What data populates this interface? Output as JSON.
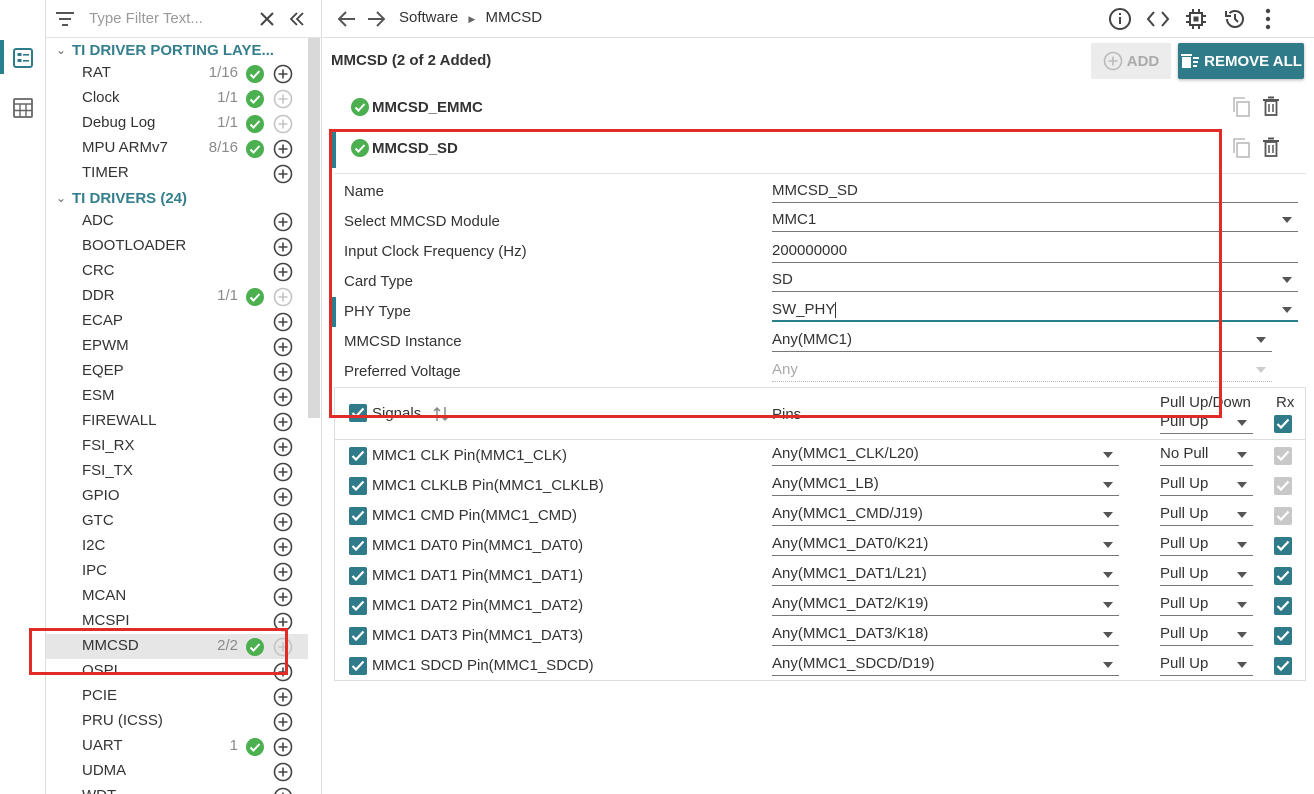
{
  "rail": {
    "items": [
      {
        "icon": "config-list-icon",
        "selected": true
      },
      {
        "icon": "calculator-icon",
        "selected": false
      }
    ]
  },
  "filter": {
    "placeholder": "Type Filter Text..."
  },
  "sections": [
    {
      "title": "TI DRIVER PORTING LAYE...",
      "items": [
        {
          "label": "RAT",
          "count": "1/16",
          "ok": true
        },
        {
          "label": "Clock",
          "count": "1/1",
          "ok": true,
          "add_disabled": true
        },
        {
          "label": "Debug Log",
          "count": "1/1",
          "ok": true,
          "add_disabled": true
        },
        {
          "label": "MPU ARMv7",
          "count": "8/16",
          "ok": true
        },
        {
          "label": "TIMER",
          "count": "",
          "ok": false
        }
      ]
    },
    {
      "title": "TI DRIVERS (24)",
      "items": [
        {
          "label": "ADC",
          "count": ""
        },
        {
          "label": "BOOTLOADER",
          "count": ""
        },
        {
          "label": "CRC",
          "count": ""
        },
        {
          "label": "DDR",
          "count": "1/1",
          "ok": true,
          "add_disabled": true
        },
        {
          "label": "ECAP",
          "count": ""
        },
        {
          "label": "EPWM",
          "count": ""
        },
        {
          "label": "EQEP",
          "count": ""
        },
        {
          "label": "ESM",
          "count": ""
        },
        {
          "label": "FIREWALL",
          "count": ""
        },
        {
          "label": "FSI_RX",
          "count": ""
        },
        {
          "label": "FSI_TX",
          "count": ""
        },
        {
          "label": "GPIO",
          "count": ""
        },
        {
          "label": "GTC",
          "count": ""
        },
        {
          "label": "I2C",
          "count": ""
        },
        {
          "label": "IPC",
          "count": ""
        },
        {
          "label": "MCAN",
          "count": ""
        },
        {
          "label": "MCSPI",
          "count": ""
        },
        {
          "label": "MMCSD",
          "count": "2/2",
          "ok": true,
          "add_disabled": true,
          "active": true
        },
        {
          "label": "OSPI",
          "count": ""
        },
        {
          "label": "PCIE",
          "count": ""
        },
        {
          "label": "PRU (ICSS)",
          "count": ""
        },
        {
          "label": "UART",
          "count": "1",
          "ok": true
        },
        {
          "label": "UDMA",
          "count": ""
        },
        {
          "label": "WDT",
          "count": ""
        }
      ]
    }
  ],
  "breadcrumb": {
    "root": "Software",
    "current": "MMCSD"
  },
  "module": {
    "title": "MMCSD (2 of 2 Added)",
    "add_label": "ADD",
    "remove_all_label": "REMOVE ALL"
  },
  "instances": [
    {
      "name": "MMCSD_EMMC"
    },
    {
      "name": "MMCSD_SD"
    }
  ],
  "fields": [
    {
      "label": "Name",
      "value": "MMCSD_SD"
    },
    {
      "label": "Select MMCSD Module",
      "value": "MMC1"
    },
    {
      "label": "Input Clock Frequency (Hz)",
      "value": "200000000"
    },
    {
      "label": "Card Type",
      "value": "SD"
    },
    {
      "label": "PHY Type",
      "value": "SW_PHY"
    },
    {
      "label": "MMCSD Instance",
      "value": "Any(MMC1)"
    },
    {
      "label": "Preferred Voltage",
      "value": "Any"
    }
  ],
  "table": {
    "headers": {
      "signals": "Signals",
      "pins": "Pins",
      "pull": "Pull Up/Down",
      "rx": "Rx"
    },
    "header_pull_value": "Pull Up",
    "rows": [
      {
        "signal": "MMC1 CLK Pin(MMC1_CLK)",
        "pin": "Any(MMC1_CLK/L20)",
        "pull": "No Pull",
        "rx_enabled": false
      },
      {
        "signal": "MMC1 CLKLB Pin(MMC1_CLKLB)",
        "pin": "Any(MMC1_LB)",
        "pull": "Pull Up",
        "rx_enabled": false
      },
      {
        "signal": "MMC1 CMD Pin(MMC1_CMD)",
        "pin": "Any(MMC1_CMD/J19)",
        "pull": "Pull Up",
        "rx_enabled": false
      },
      {
        "signal": "MMC1 DAT0 Pin(MMC1_DAT0)",
        "pin": "Any(MMC1_DAT0/K21)",
        "pull": "Pull Up",
        "rx_enabled": true
      },
      {
        "signal": "MMC1 DAT1 Pin(MMC1_DAT1)",
        "pin": "Any(MMC1_DAT1/L21)",
        "pull": "Pull Up",
        "rx_enabled": true
      },
      {
        "signal": "MMC1 DAT2 Pin(MMC1_DAT2)",
        "pin": "Any(MMC1_DAT2/K19)",
        "pull": "Pull Up",
        "rx_enabled": true
      },
      {
        "signal": "MMC1 DAT3 Pin(MMC1_DAT3)",
        "pin": "Any(MMC1_DAT3/K18)",
        "pull": "Pull Up",
        "rx_enabled": true
      },
      {
        "signal": "MMC1 SDCD Pin(MMC1_SDCD)",
        "pin": "Any(MMC1_SDCD/D19)",
        "pull": "Pull Up",
        "rx_enabled": true
      }
    ]
  },
  "colors": {
    "accent": "#2f7b8a",
    "ok": "#4caf50",
    "highlight": "#e02b27"
  }
}
